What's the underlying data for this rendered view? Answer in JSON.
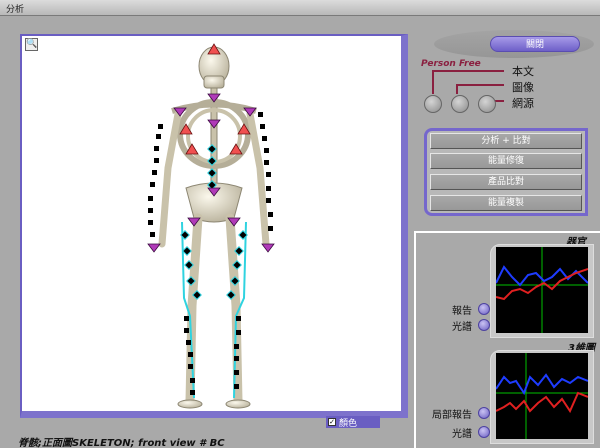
{
  "window": {
    "title": "分析"
  },
  "viewer": {
    "zoom_icon": "magnifier-icon",
    "color_toggle_label": "顏色",
    "color_checked": true
  },
  "status": {
    "text": "脊骸;正面圖SKELETON;  front  view  # BC"
  },
  "top_right": {
    "close_label": "關閉"
  },
  "brand": {
    "text": "Person Free"
  },
  "options": [
    {
      "label": "本文"
    },
    {
      "label": "圖像"
    },
    {
      "label": "網源"
    }
  ],
  "menu": {
    "items": [
      {
        "label": "分析 + 比對"
      },
      {
        "label": "能量修復"
      },
      {
        "label": "產品比對"
      },
      {
        "label": "能量複製"
      }
    ]
  },
  "graphs": [
    {
      "title": "器官",
      "buttons": [
        {
          "label": "報告"
        },
        {
          "label": "光譜"
        }
      ]
    },
    {
      "title": "3維圖",
      "buttons": [
        {
          "label": "局部報告"
        },
        {
          "label": "光譜"
        }
      ]
    }
  ],
  "colors": {
    "accent": "#6a5ec2",
    "series_red": "#e02020",
    "series_blue": "#1e3cff",
    "grid_green": "#00c000"
  }
}
